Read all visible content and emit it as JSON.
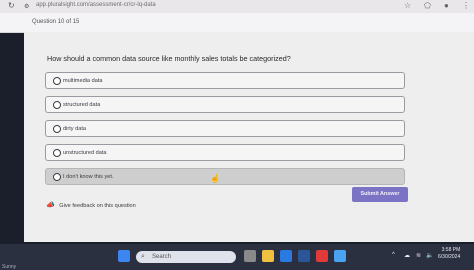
{
  "browser": {
    "url": "app.pluralsight.com/assessment-cr/cr-lq-data"
  },
  "quiz": {
    "question_number": "Question 10 of 15",
    "question_text": "How should a common data source like monthly sales totals be categorized?",
    "options": [
      {
        "label": "multimedia data"
      },
      {
        "label": "structured data"
      },
      {
        "label": "dirty data"
      },
      {
        "label": "unstructured data"
      },
      {
        "label": "I don't know this yet."
      }
    ],
    "submit_label": "Submit Answer",
    "feedback_label": "Give feedback on this question"
  },
  "taskbar": {
    "search_placeholder": "Search",
    "clock_time": "3:58 PM",
    "clock_date": "6/30/2024",
    "left_status": "Sunny"
  },
  "colors": {
    "accent": "#7b73c4",
    "page_bg": "#efeeee",
    "frame_bg": "#1b1f2c"
  }
}
